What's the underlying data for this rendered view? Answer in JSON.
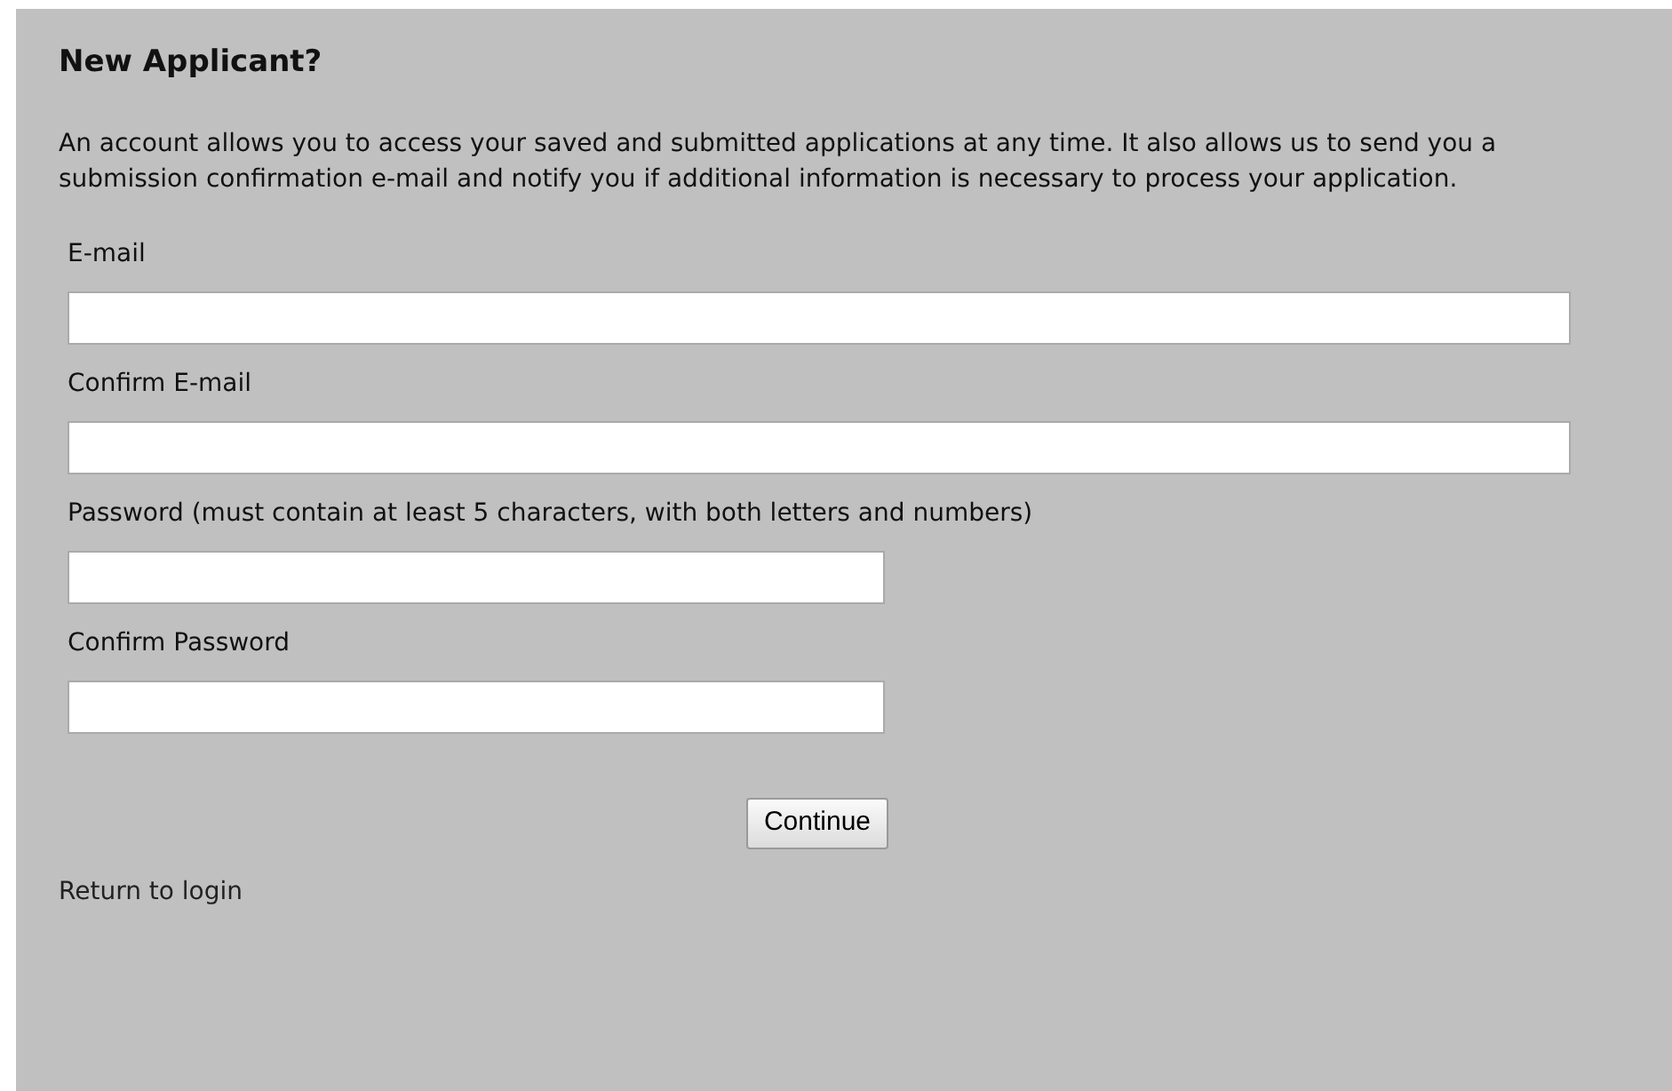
{
  "heading": "New Applicant?",
  "intro": "An account allows you to access your saved and submitted applications at any time. It also allows us to send you a submission confirmation e-mail and notify you if additional information is necessary to process your application.",
  "fields": [
    {
      "label": "E-mail",
      "kind": "wide"
    },
    {
      "label": "Confirm E-mail",
      "kind": "wide"
    },
    {
      "label": "Password (must contain at least 5 characters, with both letters and numbers)",
      "kind": "narrow"
    },
    {
      "label": "Confirm Password",
      "kind": "narrow"
    }
  ],
  "button": "Continue",
  "link": "Return to login"
}
